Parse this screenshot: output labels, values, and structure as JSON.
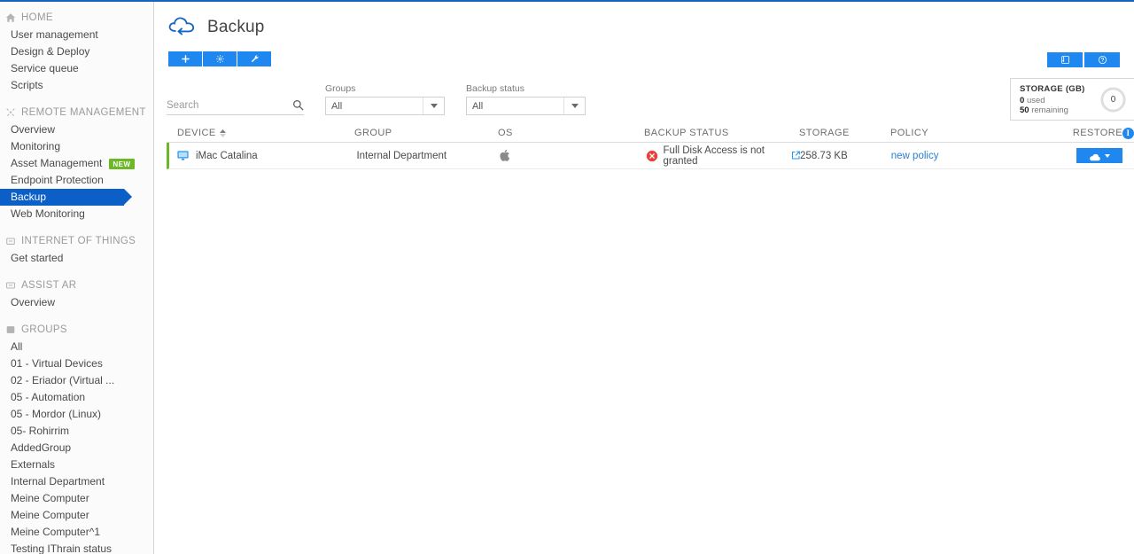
{
  "sidebar": {
    "sections": [
      {
        "icon": "home-icon",
        "title": "HOME",
        "items": [
          {
            "label": "User management"
          },
          {
            "label": "Design & Deploy"
          },
          {
            "label": "Service queue"
          },
          {
            "label": "Scripts"
          }
        ]
      },
      {
        "icon": "remote-management-icon",
        "title": "REMOTE MANAGEMENT",
        "items": [
          {
            "label": "Overview"
          },
          {
            "label": "Monitoring"
          },
          {
            "label": "Asset Management",
            "badge": "NEW"
          },
          {
            "label": "Endpoint Protection"
          },
          {
            "label": "Backup",
            "active": true
          },
          {
            "label": "Web Monitoring"
          }
        ]
      },
      {
        "icon": "iot-icon",
        "title": "INTERNET OF THINGS",
        "items": [
          {
            "label": "Get started"
          }
        ]
      },
      {
        "icon": "assist-ar-icon",
        "title": "ASSIST AR",
        "items": [
          {
            "label": "Overview"
          }
        ]
      },
      {
        "icon": "groups-icon",
        "title": "GROUPS",
        "items": [
          {
            "label": "All"
          },
          {
            "label": "01 - Virtual Devices"
          },
          {
            "label": "02 - Eriador (Virtual ..."
          },
          {
            "label": "05 - Automation"
          },
          {
            "label": "05 - Mordor (Linux)"
          },
          {
            "label": "05- Rohirrim"
          },
          {
            "label": "AddedGroup"
          },
          {
            "label": "Externals"
          },
          {
            "label": "Internal Department"
          },
          {
            "label": "Meine Computer"
          },
          {
            "label": "Meine Computer"
          },
          {
            "label": "Meine Computer^1"
          },
          {
            "label": "Testing IThrain status"
          }
        ]
      }
    ]
  },
  "header": {
    "logo_icon": "backup-cloud-icon",
    "title": "Backup"
  },
  "toolbar": {
    "buttons": [
      {
        "name": "add-backup-button",
        "icon": "plus-icon"
      },
      {
        "name": "settings-button",
        "icon": "gear-icon"
      },
      {
        "name": "tools-button",
        "icon": "wrench-icon"
      }
    ]
  },
  "top_right_actions": [
    {
      "name": "manual-button",
      "icon": "book-icon"
    },
    {
      "name": "help-button",
      "icon": "question-circle-icon"
    }
  ],
  "storage": {
    "title": "STORAGE (GB)",
    "used_value": "0",
    "used_label": "used",
    "remaining_value": "50",
    "remaining_label": "remaining",
    "gauge_value": "0",
    "gauge_percent": 0
  },
  "filters": {
    "search": {
      "placeholder": "Search",
      "value": "",
      "icon": "search-icon"
    },
    "groups": {
      "label": "Groups",
      "value": "All"
    },
    "backup_status": {
      "label": "Backup status",
      "value": "All"
    }
  },
  "table": {
    "columns": [
      {
        "label": "DEVICE",
        "sortable": true
      },
      {
        "label": "GROUP"
      },
      {
        "label": "OS"
      },
      {
        "label": "BACKUP STATUS"
      },
      {
        "label": "STORAGE"
      },
      {
        "label": "POLICY"
      },
      {
        "label": "RESTORE"
      }
    ],
    "info_badge": "i",
    "rows": [
      {
        "device": "iMac Catalina",
        "device_icon": "monitor-icon",
        "group": "Internal Department",
        "os_icon": "apple-icon",
        "status_icon": "error-circle-icon",
        "status": "Full Disk Access is not granted",
        "status_link_icon": "external-link-icon",
        "storage": "258.73 KB",
        "policy": "new policy",
        "restore_label": "",
        "restore_icon": "cloud-download-icon"
      }
    ]
  },
  "colors": {
    "accent_blue": "#1e88f0",
    "nav_active_blue": "#0b5fc7",
    "badge_green": "#6cb825",
    "row_accent_green": "#6cb825",
    "error_red": "#e8413c",
    "link_blue": "#2a7fd4"
  }
}
